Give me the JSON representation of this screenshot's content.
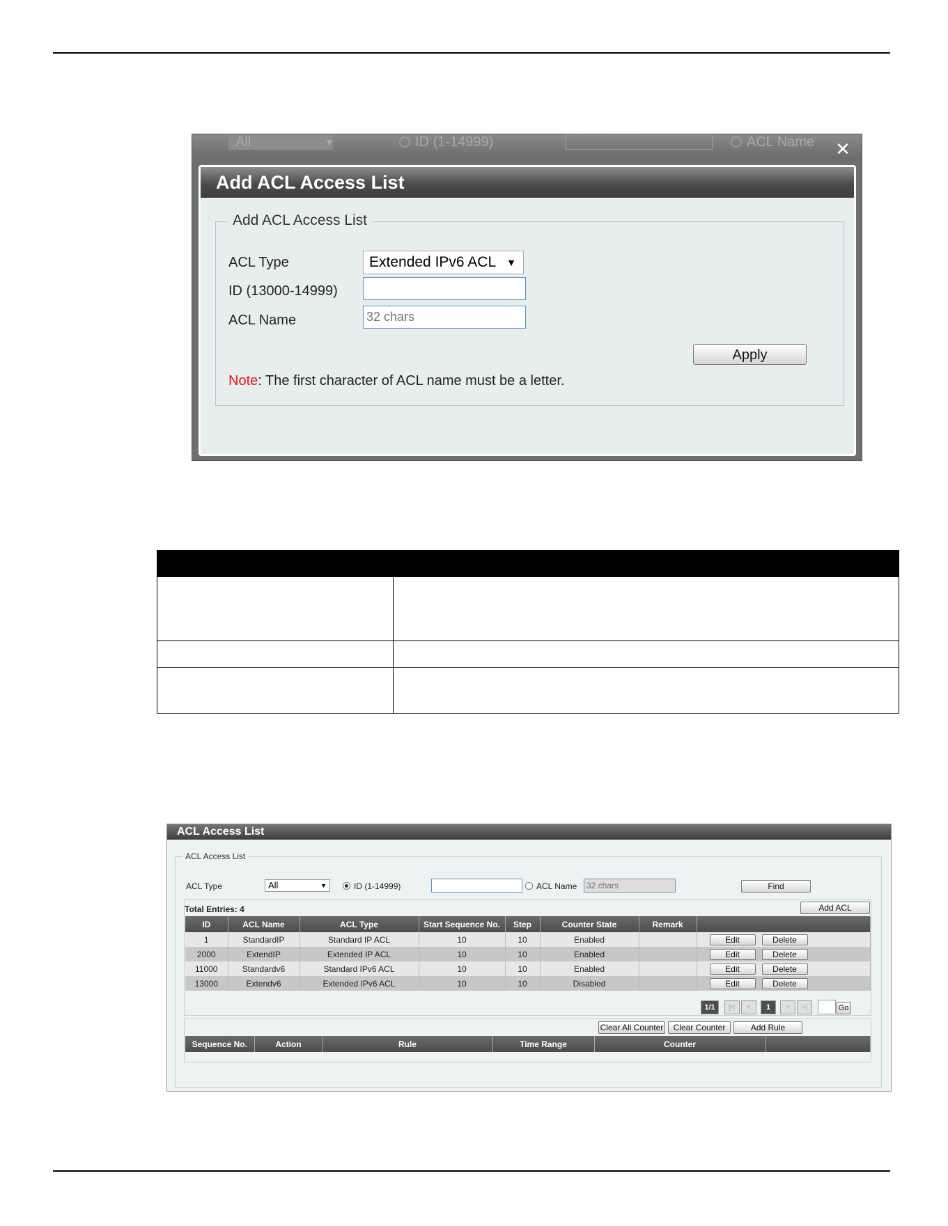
{
  "dialog": {
    "background_bar": {
      "acl_type_value": "All",
      "id_radio_label": "ID (1-14999)",
      "name_radio_label": "ACL Name"
    },
    "title": "Add ACL Access List",
    "legend": "Add ACL Access List",
    "acl_type_label": "ACL Type",
    "acl_type_value": "Extended IPv6 ACL",
    "id_label": "ID (13000-14999)",
    "id_value": "",
    "name_label": "ACL Name",
    "name_placeholder": "32 chars",
    "apply_label": "Apply",
    "note_key": "Note",
    "note_text": ":  The first character of ACL name must be a letter."
  },
  "acl_list": {
    "title": "ACL Access List",
    "legend": "ACL Access List",
    "acl_type_label": "ACL Type",
    "acl_type_value": "All",
    "id_radio_label": "ID (1-14999)",
    "name_radio_label": "ACL Name",
    "name_placeholder": "32 chars",
    "find_label": "Find",
    "total_entries": "Total Entries: 4",
    "add_acl_label": "Add ACL",
    "columns": [
      "ID",
      "ACL Name",
      "ACL Type",
      "Start Sequence No.",
      "Step",
      "Counter State",
      "Remark",
      ""
    ],
    "rows": [
      {
        "id": "1",
        "name": "StandardIP",
        "type": "Standard IP ACL",
        "start": "10",
        "step": "10",
        "state": "Enabled",
        "remark": ""
      },
      {
        "id": "2000",
        "name": "ExtendIP",
        "type": "Extended IP ACL",
        "start": "10",
        "step": "10",
        "state": "Enabled",
        "remark": ""
      },
      {
        "id": "11000",
        "name": "Standardv6",
        "type": "Standard IPv6 ACL",
        "start": "10",
        "step": "10",
        "state": "Enabled",
        "remark": ""
      },
      {
        "id": "13000",
        "name": "Extendv6",
        "type": "Extended IPv6 ACL",
        "start": "10",
        "step": "10",
        "state": "Disabled",
        "remark": ""
      }
    ],
    "edit_label": "Edit",
    "delete_label": "Delete",
    "pagination": {
      "indicator": "1/1",
      "first": "|<",
      "prev": "<",
      "current": "1",
      "next": ">",
      "last": ">|",
      "go_label": "Go"
    },
    "clear_all_counter_label": "Clear All Counter",
    "clear_counter_label": "Clear Counter",
    "add_rule_label": "Add Rule",
    "rule_columns": [
      "Sequence No.",
      "Action",
      "Rule",
      "Time Range",
      "Counter",
      ""
    ]
  }
}
